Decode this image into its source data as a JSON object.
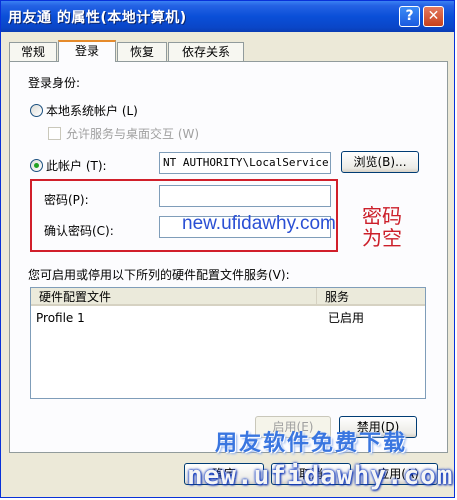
{
  "window": {
    "title": "用友通  的属性(本地计算机)",
    "help_button": "?",
    "close_button": "✕"
  },
  "tabs": [
    {
      "label": "常规",
      "active": false
    },
    {
      "label": "登录",
      "active": true
    },
    {
      "label": "恢复",
      "active": false
    },
    {
      "label": "依存关系",
      "active": false
    }
  ],
  "logon": {
    "section_label": "登录身份:",
    "local_system_account": "本地系统帐户 (L)",
    "allow_desktop_interact": "允许服务与桌面交互 (W)",
    "this_account": "此帐户 (T):",
    "account_value": "NT AUTHORITY\\LocalService",
    "browse_button": "浏览(B)...",
    "password_label": "密码(P):",
    "password_value": "",
    "confirm_password_label": "确认密码(C):",
    "confirm_password_value": ""
  },
  "annotations": {
    "watermark": "new.ufidawhy.com",
    "note_line1": "密码",
    "note_line2": "为空",
    "highlight_color": "#d11f2a"
  },
  "hardware": {
    "description": "您可启用或停用以下所列的硬件配置文件服务(V):",
    "columns": [
      "硬件配置文件",
      "服务"
    ],
    "rows": [
      {
        "profile": "Profile 1",
        "service": "已启用"
      }
    ],
    "enable_button": "启用(E)",
    "disable_button": "禁用(D)"
  },
  "footer": {
    "ok_button": "确定",
    "cancel_button": "取消",
    "apply_button": "应用(A)",
    "brand_text": "用友软件免费下载",
    "brand_url": "new.ufidawhy.com"
  }
}
